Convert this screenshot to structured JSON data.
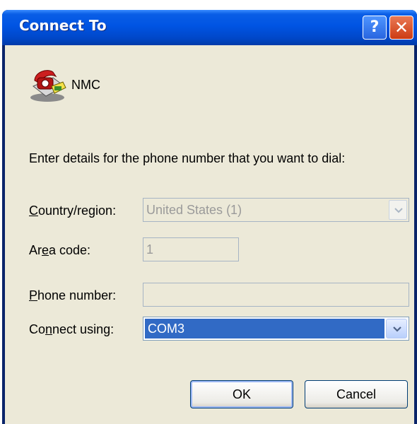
{
  "window": {
    "title": "Connect To",
    "help_glyph": "?",
    "close_glyph": "✕"
  },
  "entry": {
    "name": "NMC",
    "icon": "phone-icon"
  },
  "prompt": "Enter details for the phone number that you want to dial:",
  "fields": {
    "country": {
      "label_u": "C",
      "label_rest": "ountry/region:",
      "value": "United States (1)"
    },
    "area": {
      "label_pre": "Ar",
      "label_u": "e",
      "label_rest": "a code:",
      "value": "1"
    },
    "phone": {
      "label_u": "P",
      "label_rest": "hone number:",
      "value": ""
    },
    "connect": {
      "label_pre": "Co",
      "label_u": "n",
      "label_rest": "nect using:",
      "value": "COM3"
    }
  },
  "buttons": {
    "ok": "OK",
    "cancel": "Cancel"
  },
  "colors": {
    "titlebar": "#0054e3",
    "selection": "#316ac5",
    "dialog_bg": "#ece9d8"
  }
}
